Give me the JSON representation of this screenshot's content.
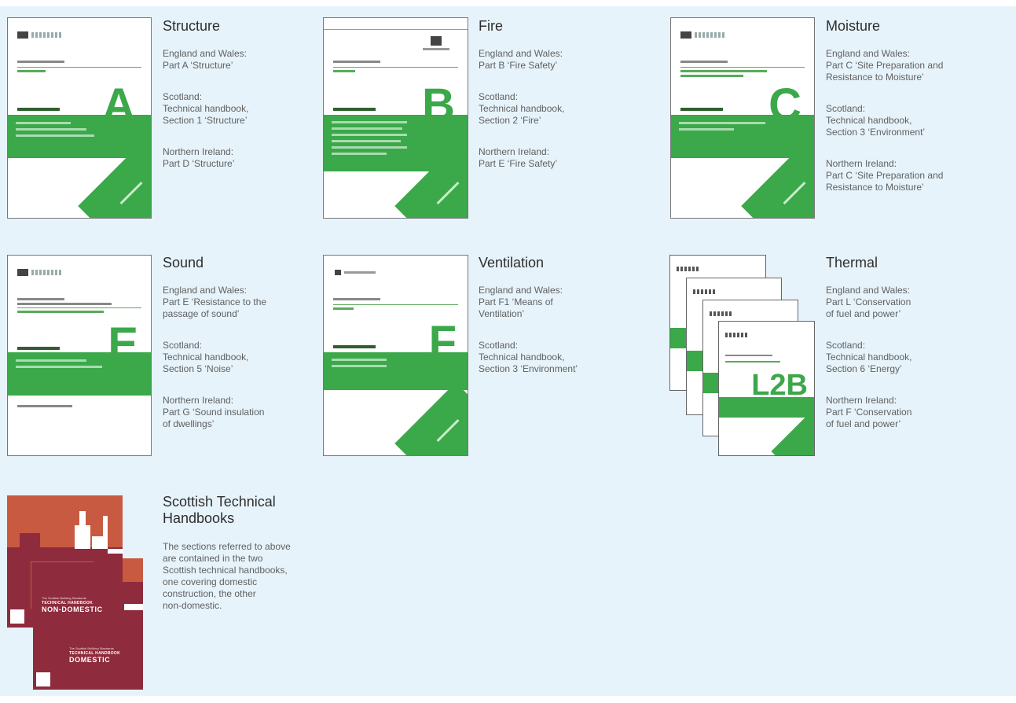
{
  "entries": {
    "structure": {
      "title": "Structure",
      "lines": [
        "England and Wales:\nPart A ‘Structure’",
        "Scotland:\nTechnical handbook,\nSection 1 ‘Structure’",
        "Northern Ireland:\nPart D ‘Structure’"
      ],
      "cover_letter": "A"
    },
    "fire": {
      "title": "Fire",
      "lines": [
        "England and Wales:\nPart B ‘Fire Safety’",
        "Scotland:\nTechnical handbook,\nSection 2 ‘Fire’",
        "Northern Ireland:\nPart E ‘Fire Safety’"
      ],
      "cover_letter": "B"
    },
    "moisture": {
      "title": "Moisture",
      "lines": [
        "England and Wales:\nPart C ‘Site Preparation and\nResistance to Moisture’",
        "Scotland:\nTechnical handbook,\nSection 3 ‘Environment’",
        "Northern Ireland:\nPart C ‘Site Preparation and\nResistance to Moisture’"
      ],
      "cover_letter": "C"
    },
    "sound": {
      "title": "Sound",
      "lines": [
        "England and Wales:\nPart E ‘Resistance to the\npassage of sound’",
        "Scotland:\nTechnical handbook,\nSection 5 ‘Noise’",
        "Northern Ireland:\nPart G ‘Sound insulation\nof dwellings’"
      ],
      "cover_letter": "E"
    },
    "ventilation": {
      "title": "Ventilation",
      "lines": [
        "England and Wales:\nPart F1 ‘Means of\nVentilation’",
        "Scotland:\nTechnical handbook,\nSection 3 ‘Environment’"
      ],
      "cover_letter": "F"
    },
    "thermal": {
      "title": "Thermal",
      "lines": [
        "England and Wales:\nPart L ‘Conservation\nof fuel and power’",
        "Scotland:\nTechnical handbook,\nSection 6 ‘Energy’",
        "Northern Ireland:\nPart F ‘Conservation\nof fuel and power’"
      ],
      "cover_letter": "L2B"
    },
    "scottish": {
      "title": "Scottish Technical\nHandbooks",
      "lines": [
        "The sections referred to above\nare contained in the two\nScottish technical handbooks,\none covering domestic\nconstruction, the other\nnon-domestic."
      ]
    }
  },
  "handbooks": {
    "series": "The Scottish Building Standards",
    "title": "TECHNICAL HANDBOOK",
    "non_domestic": "NON-DOMESTIC",
    "domestic": "DOMESTIC"
  },
  "colors": {
    "panel": "#e6f3fb",
    "green": "#3ba84a",
    "maroon": "#8e2b3c",
    "orange": "#c85a42"
  }
}
